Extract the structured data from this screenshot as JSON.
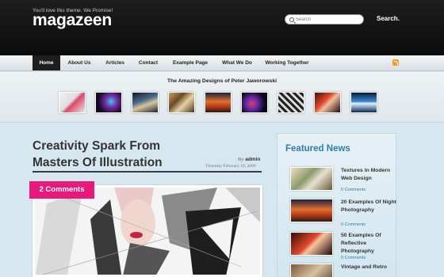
{
  "header": {
    "tagline": "You'll love this theme. We Promise!",
    "logo": "magazeen",
    "search_placeholder": "Search",
    "search_button": "Search."
  },
  "nav": {
    "items": [
      "Home",
      "About Us",
      "Articles",
      "Contact",
      "Example Page",
      "What We Do",
      "Working Together"
    ],
    "active": "Home"
  },
  "gallery": {
    "title": "The Amazing Designs of Peter Jaworowski",
    "thumbs": [
      "thumb-1",
      "thumb-2",
      "thumb-3",
      "thumb-4",
      "thumb-5",
      "thumb-6",
      "thumb-7",
      "thumb-8",
      "thumb-9"
    ]
  },
  "post": {
    "title": "Creativity Spark From Masters Of Illustration",
    "by_prefix": "By",
    "author": "admin",
    "date": "Thursday February 19, 2009",
    "comments": "2 Comments"
  },
  "sidebar": {
    "title": "Featured News",
    "items": [
      {
        "title": "Textures In Modern Web Design",
        "comments": "0 Comments"
      },
      {
        "title": "20 Examples Of Night Photography",
        "comments": "0 Comments"
      },
      {
        "title": "50 Examples Of Reflective Photography",
        "comments": "0 Comments"
      },
      {
        "title": "Vintage and Retro",
        "comments": ""
      }
    ]
  },
  "icons": {
    "search": "search-icon",
    "rss": "rss-icon"
  },
  "colors": {
    "accent": "#e8197c",
    "link": "#2d7fa5",
    "header": "#111111"
  }
}
